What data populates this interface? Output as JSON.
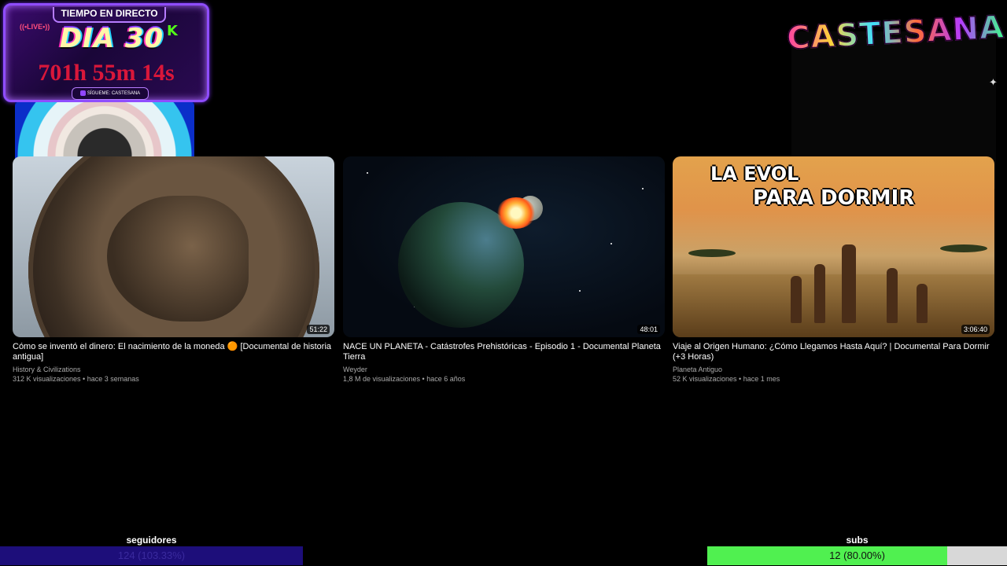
{
  "overlay": {
    "timer": {
      "header": "TIEMPO EN DIRECTO",
      "live_badge": "((•LIVE•))",
      "day": "DIA 30",
      "kick_icon": "K",
      "elapsed": "701h 55m 14s",
      "follow": "SÍGUEME: CASTESANA"
    },
    "brand": "CASTESANA"
  },
  "videos": [
    {
      "title": "Cómo se inventó el dinero: El nacimiento de la moneda 🟠 [Documental de historia antigua]",
      "channel": "History & Civilizations",
      "meta": "312 K visualizaciones • hace 3 semanas",
      "duration": "51:22"
    },
    {
      "title": "NACE UN PLANETA - Catástrofes Prehistóricas - Episodio 1 - Documental Planeta Tierra",
      "channel": "Weyder",
      "meta": "1,8 M de visualizaciones • hace 6 años",
      "duration": "48:01"
    },
    {
      "title": "Viaje al Origen Humano: ¿Cómo Llegamos Hasta Aquí? | Documental Para Dormir (+3 Horas)",
      "channel": "Planeta Antiguo",
      "meta": "52 K visualizaciones • hace 1 mes",
      "duration": "3:06:40",
      "thumb_caption_1": "LA EVOL",
      "thumb_caption_2": "PARA DORMIR"
    }
  ],
  "goals": {
    "followers": {
      "label": "seguidores",
      "value_text": "124 (103.33%)",
      "fraction": 1.0,
      "fill_color": "#1d0e7a",
      "text_color": "#3a2a9e"
    },
    "subs": {
      "label": "subs",
      "value_text": "12 (80.00%)",
      "fraction": 0.8,
      "fill_color": "#50f050",
      "track_color": "#d8d8d8",
      "text_color": "#111111"
    }
  }
}
